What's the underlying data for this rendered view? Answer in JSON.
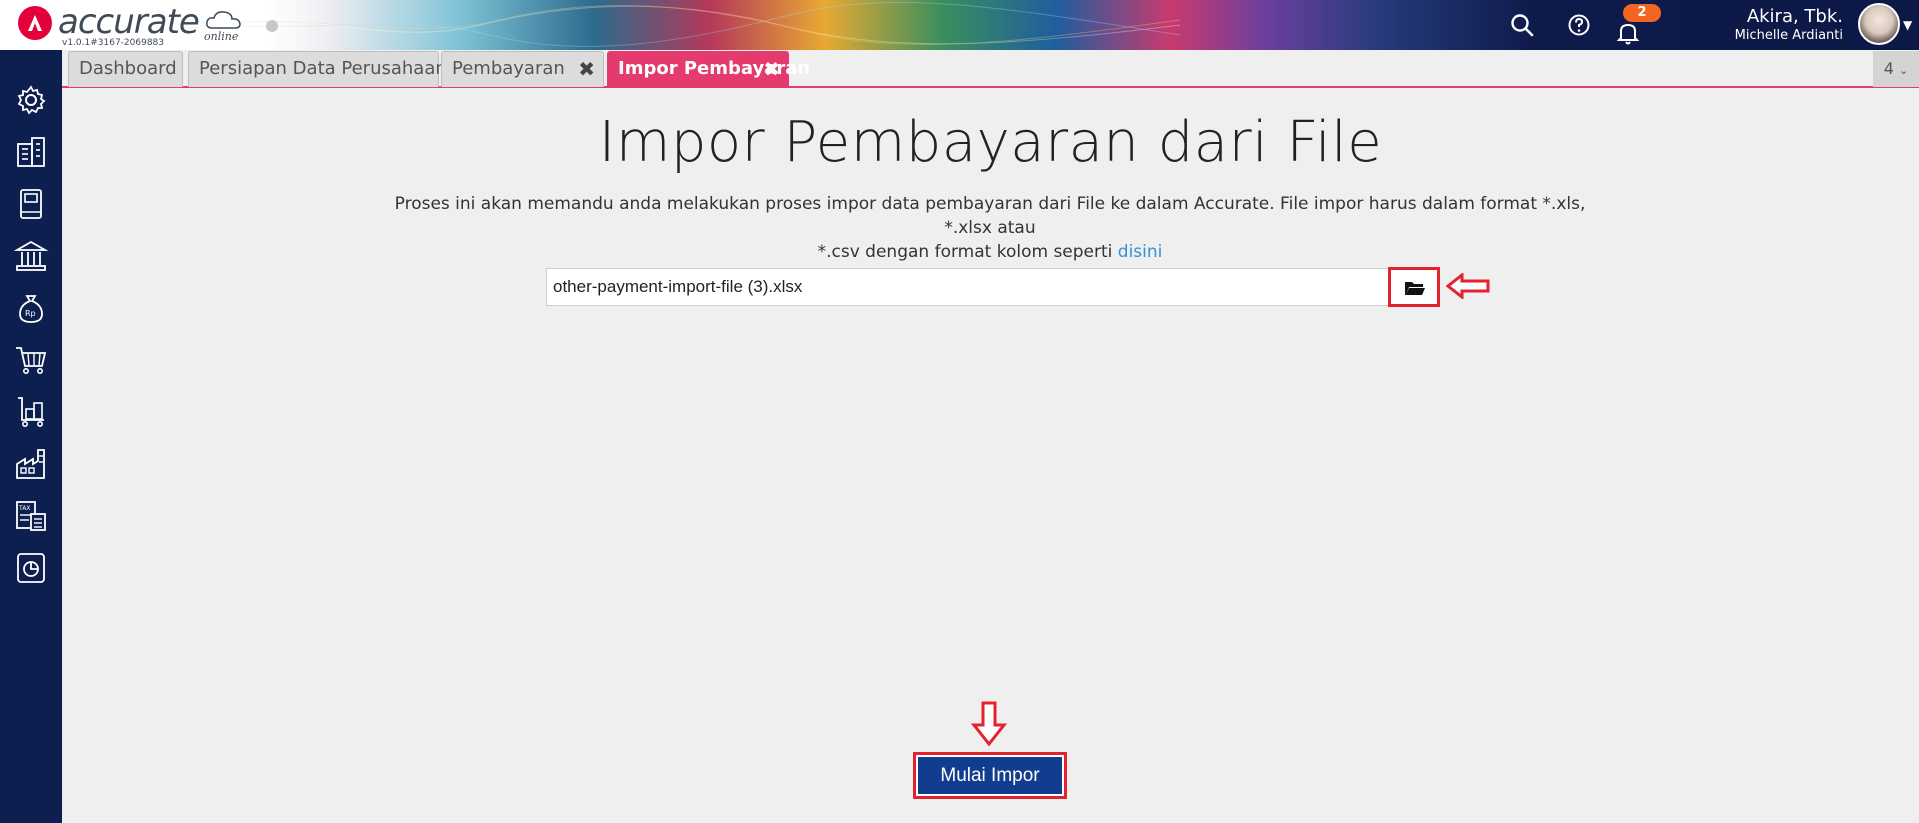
{
  "app": {
    "logo_text": "accurate",
    "logo_suffix": "online",
    "version": "v1.0.1#3167-2069883"
  },
  "header": {
    "notification_count": "2",
    "user_company": "Akira, Tbk.",
    "user_name": "Michelle Ardianti",
    "icons": [
      "search-icon",
      "help-icon",
      "bell-icon"
    ]
  },
  "sidebar": {
    "items": [
      {
        "icon": "gear-icon"
      },
      {
        "icon": "building-icon"
      },
      {
        "icon": "ledger-book-icon"
      },
      {
        "icon": "bank-icon"
      },
      {
        "icon": "money-bag-icon"
      },
      {
        "icon": "shopping-cart-icon"
      },
      {
        "icon": "trolley-boxes-icon"
      },
      {
        "icon": "factory-icon"
      },
      {
        "icon": "tax-calculator-icon"
      },
      {
        "icon": "report-chart-icon"
      }
    ]
  },
  "tabs": [
    {
      "label": "Dashboard",
      "closable": false,
      "active": false
    },
    {
      "label": "Persiapan Data Perusahaan",
      "closable": false,
      "active": false
    },
    {
      "label": "Pembayaran",
      "closable": true,
      "active": false
    },
    {
      "label": "Impor Pembayaran",
      "closable": true,
      "active": true
    }
  ],
  "tab_counter": "4",
  "main": {
    "title": "Impor Pembayaran dari File",
    "description_line1": "Proses ini akan memandu anda melakukan proses impor data pembayaran dari File ke dalam Accurate. File impor harus dalam format *.xls, *.xlsx atau",
    "description_line2": "*.csv dengan format kolom seperti",
    "description_link": "disini",
    "file_value": "other-payment-import-file (3).xlsx",
    "start_button": "Mulai Impor"
  },
  "colors": {
    "sidebar": "#0d1f4f",
    "active_tab": "#e53a6e",
    "primary_button": "#123d8e",
    "annotation": "#e3212f",
    "badge": "#f26522"
  }
}
